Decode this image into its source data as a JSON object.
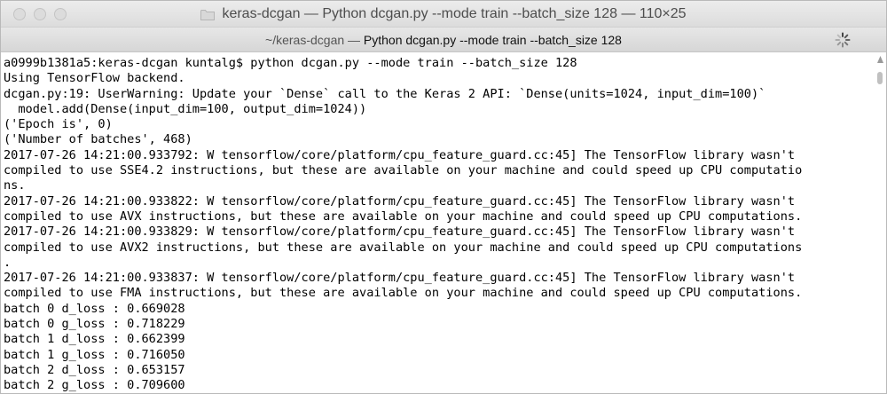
{
  "window": {
    "title": "keras-dcgan — Python dcgan.py --mode train --batch_size 128 — 110×25"
  },
  "tab": {
    "path": "~/keras-dcgan —",
    "command": "Python dcgan.py --mode train --batch_size 128"
  },
  "terminal": {
    "lines": [
      "a0999b1381a5:keras-dcgan kuntalg$ python dcgan.py --mode train --batch_size 128",
      "Using TensorFlow backend.",
      "dcgan.py:19: UserWarning: Update your `Dense` call to the Keras 2 API: `Dense(units=1024, input_dim=100)`",
      "  model.add(Dense(input_dim=100, output_dim=1024))",
      "('Epoch is', 0)",
      "('Number of batches', 468)",
      "2017-07-26 14:21:00.933792: W tensorflow/core/platform/cpu_feature_guard.cc:45] The TensorFlow library wasn't",
      "compiled to use SSE4.2 instructions, but these are available on your machine and could speed up CPU computatio",
      "ns.",
      "2017-07-26 14:21:00.933822: W tensorflow/core/platform/cpu_feature_guard.cc:45] The TensorFlow library wasn't",
      "compiled to use AVX instructions, but these are available on your machine and could speed up CPU computations.",
      "2017-07-26 14:21:00.933829: W tensorflow/core/platform/cpu_feature_guard.cc:45] The TensorFlow library wasn't",
      "compiled to use AVX2 instructions, but these are available on your machine and could speed up CPU computations",
      ".",
      "2017-07-26 14:21:00.933837: W tensorflow/core/platform/cpu_feature_guard.cc:45] The TensorFlow library wasn't",
      "compiled to use FMA instructions, but these are available on your machine and could speed up CPU computations.",
      "batch 0 d_loss : 0.669028",
      "batch 0 g_loss : 0.718229",
      "batch 1 d_loss : 0.662399",
      "batch 1 g_loss : 0.716050",
      "batch 2 d_loss : 0.653157",
      "batch 2 g_loss : 0.709600"
    ]
  },
  "icons": {
    "folder": "folder-icon",
    "spinner": "activity-spinner-icon",
    "scroll": "scroll-up-icon"
  },
  "colors": {
    "titlebar": "#e4e4e4",
    "text": "#000000",
    "traffic": "#dcdcdc"
  }
}
